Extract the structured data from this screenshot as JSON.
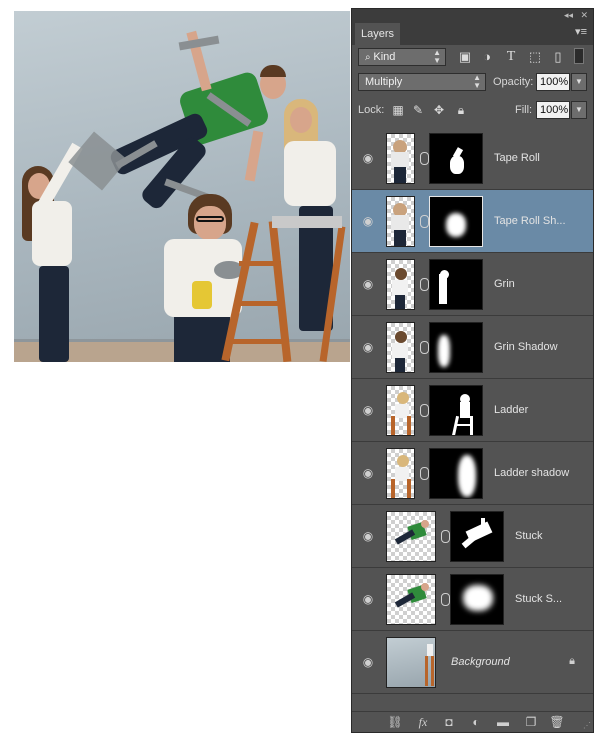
{
  "panel": {
    "tab_label": "Layers",
    "collapse_glyph": "◂◂",
    "close_glyph": "✕",
    "menu_glyph": "▾≡"
  },
  "filter": {
    "kind_icon": "search-icon",
    "kind_label": "Kind",
    "icons": [
      "image-filter-icon",
      "adjustment-filter-icon",
      "type-filter-icon",
      "shape-filter-icon",
      "smart-object-filter-icon"
    ]
  },
  "blend": {
    "mode": "Multiply",
    "opacity_label": "Opacity:",
    "opacity_value": "100%"
  },
  "lock": {
    "label": "Lock:",
    "icons": [
      "lock-transparent-pixels-icon",
      "lock-image-pixels-icon",
      "lock-position-icon",
      "lock-all-icon"
    ],
    "fill_label": "Fill:",
    "fill_value": "100%"
  },
  "layers": [
    {
      "name": "Tape Roll",
      "selected": false,
      "has_mask": true
    },
    {
      "name": "Tape Roll Sh...",
      "selected": true,
      "has_mask": true
    },
    {
      "name": "Grin",
      "selected": false,
      "has_mask": true
    },
    {
      "name": "Grin Shadow",
      "selected": false,
      "has_mask": true
    },
    {
      "name": "Ladder",
      "selected": false,
      "has_mask": true
    },
    {
      "name": "Ladder shadow",
      "selected": false,
      "has_mask": true
    },
    {
      "name": "Stuck",
      "selected": false,
      "has_mask": true
    },
    {
      "name": "Stuck S...",
      "selected": false,
      "has_mask": true
    },
    {
      "name": "Background",
      "selected": false,
      "has_mask": false,
      "locked": true
    }
  ],
  "bottom_icons": [
    "link-layers-icon",
    "fx-icon",
    "add-mask-icon",
    "new-adjustment-icon",
    "new-group-icon",
    "new-layer-icon",
    "trash-icon"
  ],
  "colors": {
    "panel_bg": "#535353",
    "selected_row": "#6a8aa6",
    "tab_bar": "#3c3c3c"
  }
}
